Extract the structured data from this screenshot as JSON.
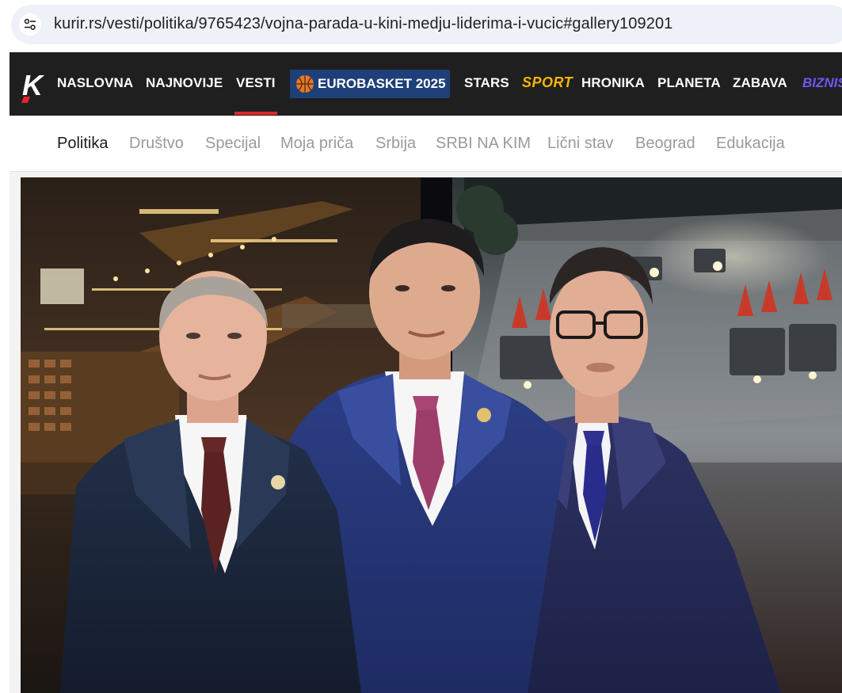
{
  "browser": {
    "url": "kurir.rs/vesti/politika/9765423/vojna-parada-u-kini-medju-liderima-i-vucic#gallery109201",
    "site_info_icon": "tune-icon"
  },
  "top_nav": {
    "logo_letter": "K",
    "items": [
      {
        "label": "NASLOVNA"
      },
      {
        "label": "NAJNOVIJE"
      },
      {
        "label": "VESTI",
        "active": true
      },
      {
        "label": "EUROBASKET 2025",
        "icon": "basketball-icon"
      },
      {
        "label": "STARS"
      },
      {
        "label": "SPORT"
      },
      {
        "label": "HRONIKA"
      },
      {
        "label": "PLANETA"
      },
      {
        "label": "ZABAVA"
      },
      {
        "label": "BIZNIS"
      }
    ],
    "colors": {
      "background": "#1f1f1f",
      "active_underline": "#e3242b",
      "eurobasket_badge": "#1f3f78",
      "sport": "#f7b500",
      "biznis": "#6d58f2"
    }
  },
  "sub_nav": {
    "items": [
      {
        "label": "Politika",
        "active": true
      },
      {
        "label": "Društvo"
      },
      {
        "label": "Specijal"
      },
      {
        "label": "Moja priča"
      },
      {
        "label": "Srbija"
      },
      {
        "label": "SRBI NA KIM"
      },
      {
        "label": "Lični stav"
      },
      {
        "label": "Beograd"
      },
      {
        "label": "Edukacija"
      }
    ]
  },
  "hero": {
    "description_icon": "article-photo"
  }
}
